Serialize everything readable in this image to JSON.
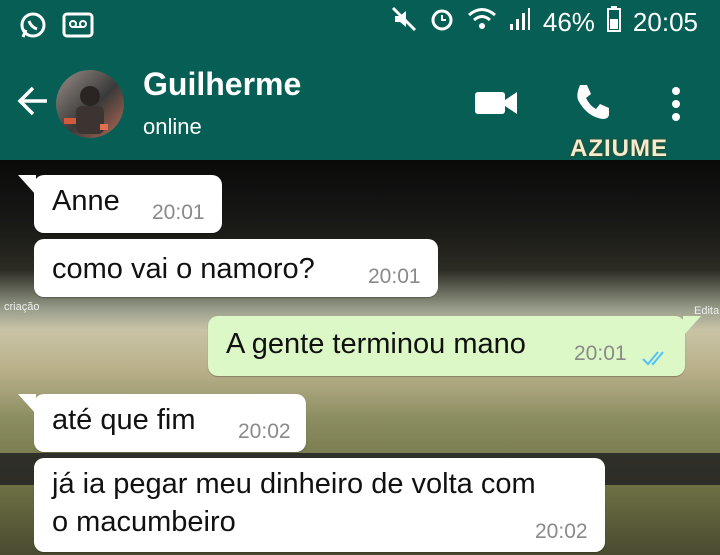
{
  "status_bar": {
    "battery": "46%",
    "time": "20:05",
    "icons": [
      "whatsapp-icon",
      "voicemail-icon",
      "mute-icon",
      "alarm-icon",
      "wifi-icon",
      "signal-icon",
      "battery-icon"
    ]
  },
  "header": {
    "name": "Guilherme",
    "status": "online",
    "icons": [
      "back-arrow-icon",
      "video-call-icon",
      "phone-icon",
      "more-icon"
    ]
  },
  "watermark": "AZIUME",
  "wallpaper_overlay": {
    "left": "criação",
    "right": "Edita"
  },
  "messages": [
    {
      "text": "Anne",
      "time": "20:01",
      "direction": "incoming"
    },
    {
      "text": "como vai o namoro?",
      "time": "20:01",
      "direction": "incoming"
    },
    {
      "text": "A gente terminou mano",
      "time": "20:01",
      "direction": "outgoing",
      "read": true
    },
    {
      "text": "até que fim",
      "time": "20:02",
      "direction": "incoming"
    },
    {
      "text_line1": "já ia pegar meu dinheiro de volta com",
      "text_line2": "o macumbeiro",
      "time": "20:02",
      "direction": "incoming"
    }
  ],
  "colors": {
    "header": "#075e54",
    "incoming_bubble": "#ffffff",
    "outgoing_bubble": "#dcf8c6",
    "read_ticks": "#4fc3f7"
  }
}
